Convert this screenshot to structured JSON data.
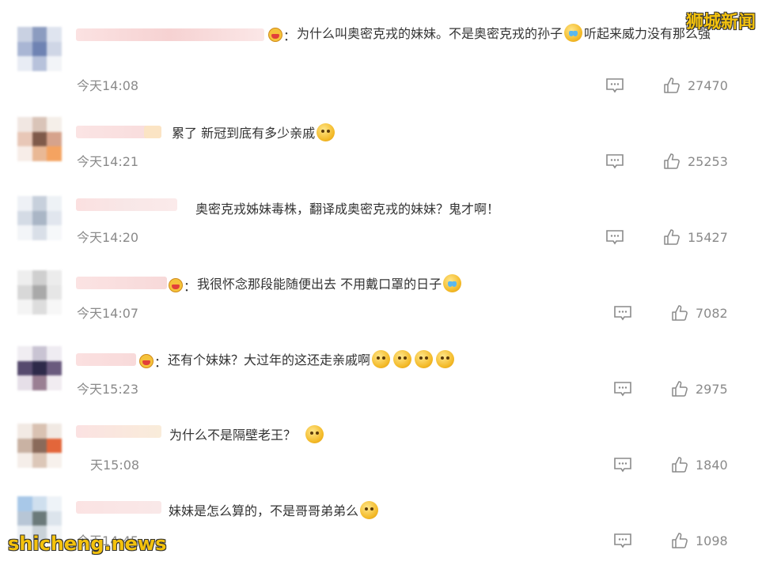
{
  "watermarks": {
    "top": "狮城新闻",
    "bottom": "shicheng.news"
  },
  "comments": [
    {
      "text": "为什么叫奥密克戎的妹妹。不是奥密克戎的孙子",
      "text2": "听起来威力没有那么强",
      "time": "今天14:08",
      "likes": "27470"
    },
    {
      "text": "累了 新冠到底有多少亲戚",
      "time": "今天14:21",
      "likes": "25253"
    },
    {
      "text": "奥密克戎姊妹毒株，翻译成奥密克戎的妹妹？鬼才啊！",
      "time": "今天14:20",
      "likes": "15427"
    },
    {
      "text": "我很怀念那段能随便出去 不用戴口罩的日子",
      "time": "今天14:07",
      "likes": "7082"
    },
    {
      "text": "还有个妹妹？大过年的这还走亲戚啊",
      "time": "今天15:23",
      "likes": "2975"
    },
    {
      "text": "为什么不是隔壁老王？",
      "time": "天15:08",
      "likes": "1840"
    },
    {
      "text": "妹妹是怎么算的，不是哥哥弟弟么",
      "time": "今天14:45",
      "likes": "1098"
    }
  ],
  "icons": {
    "reply": "comment-icon",
    "like": "thumbs-up-icon"
  },
  "colors": {
    "text": "#333333",
    "meta": "#8a8a8a",
    "watermark": "#f4c20d"
  }
}
